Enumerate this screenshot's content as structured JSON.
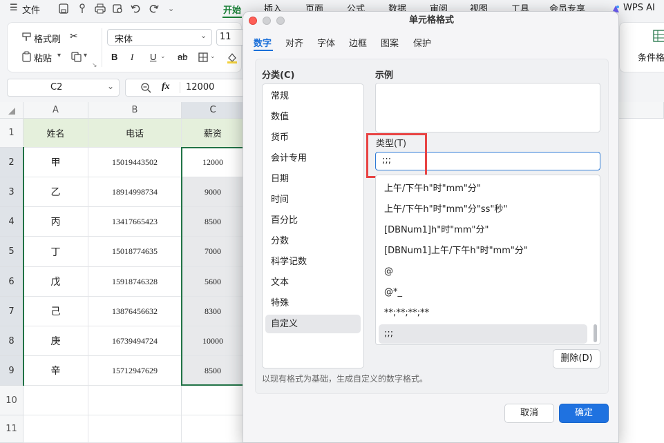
{
  "menubar": {
    "file_label": "文件",
    "tabs": [
      "开始",
      "插入",
      "页面",
      "公式",
      "数据",
      "审阅",
      "视图",
      "工具",
      "会员专享"
    ],
    "wps_ai": "WPS AI"
  },
  "ribbon": {
    "format_painter": "格式刷",
    "paste": "粘贴",
    "font_name": "宋体",
    "font_size": "11",
    "bold": "B",
    "italic": "I",
    "underline": "U",
    "strike": "ab",
    "conditional": "条件格"
  },
  "formula_bar": {
    "cell_ref": "C2",
    "fx": "fx",
    "value": "12000"
  },
  "grid": {
    "columns": [
      "A",
      "B",
      "C"
    ],
    "rows": [
      "1",
      "2",
      "3",
      "4",
      "5",
      "6",
      "7",
      "8",
      "9",
      "10",
      "11"
    ],
    "headers": [
      "姓名",
      "电话",
      "薪资"
    ],
    "data": [
      [
        "甲",
        "15019443502",
        "12000"
      ],
      [
        "乙",
        "18914998734",
        "9000"
      ],
      [
        "丙",
        "13417665423",
        "8500"
      ],
      [
        "丁",
        "15018774635",
        "7000"
      ],
      [
        "戊",
        "15918746328",
        "5600"
      ],
      [
        "己",
        "13876456632",
        "8300"
      ],
      [
        "庚",
        "16739494724",
        "10000"
      ],
      [
        "辛",
        "15712947629",
        "8500"
      ]
    ]
  },
  "dialog": {
    "title": "单元格格式",
    "tabs": [
      "数字",
      "对齐",
      "字体",
      "边框",
      "图案",
      "保护"
    ],
    "category_label": "分类(C)",
    "categories": [
      "常规",
      "数值",
      "货币",
      "会计专用",
      "日期",
      "时间",
      "百分比",
      "分数",
      "科学记数",
      "文本",
      "特殊",
      "自定义"
    ],
    "sample_label": "示例",
    "type_label": "类型(T)",
    "type_value": ";;;",
    "formats": [
      "上午/下午h\"时\"mm\"分\"",
      "上午/下午h\"时\"mm\"分\"ss\"秒\"",
      "[DBNum1]h\"时\"mm\"分\"",
      "[DBNum1]上午/下午h\"时\"mm\"分\"",
      "@",
      "@*_",
      "**;**;**;**",
      ";;;"
    ],
    "delete_button": "删除(D)",
    "hint": "以现有格式为基础，生成自定义的数字格式。",
    "cancel_button": "取消",
    "ok_button": "确定"
  },
  "colors": {
    "accent_green": "#1a7f37",
    "dialog_blue": "#1f72e0",
    "highlight_red": "#e84444",
    "header_fill": "#e5f0dc"
  }
}
